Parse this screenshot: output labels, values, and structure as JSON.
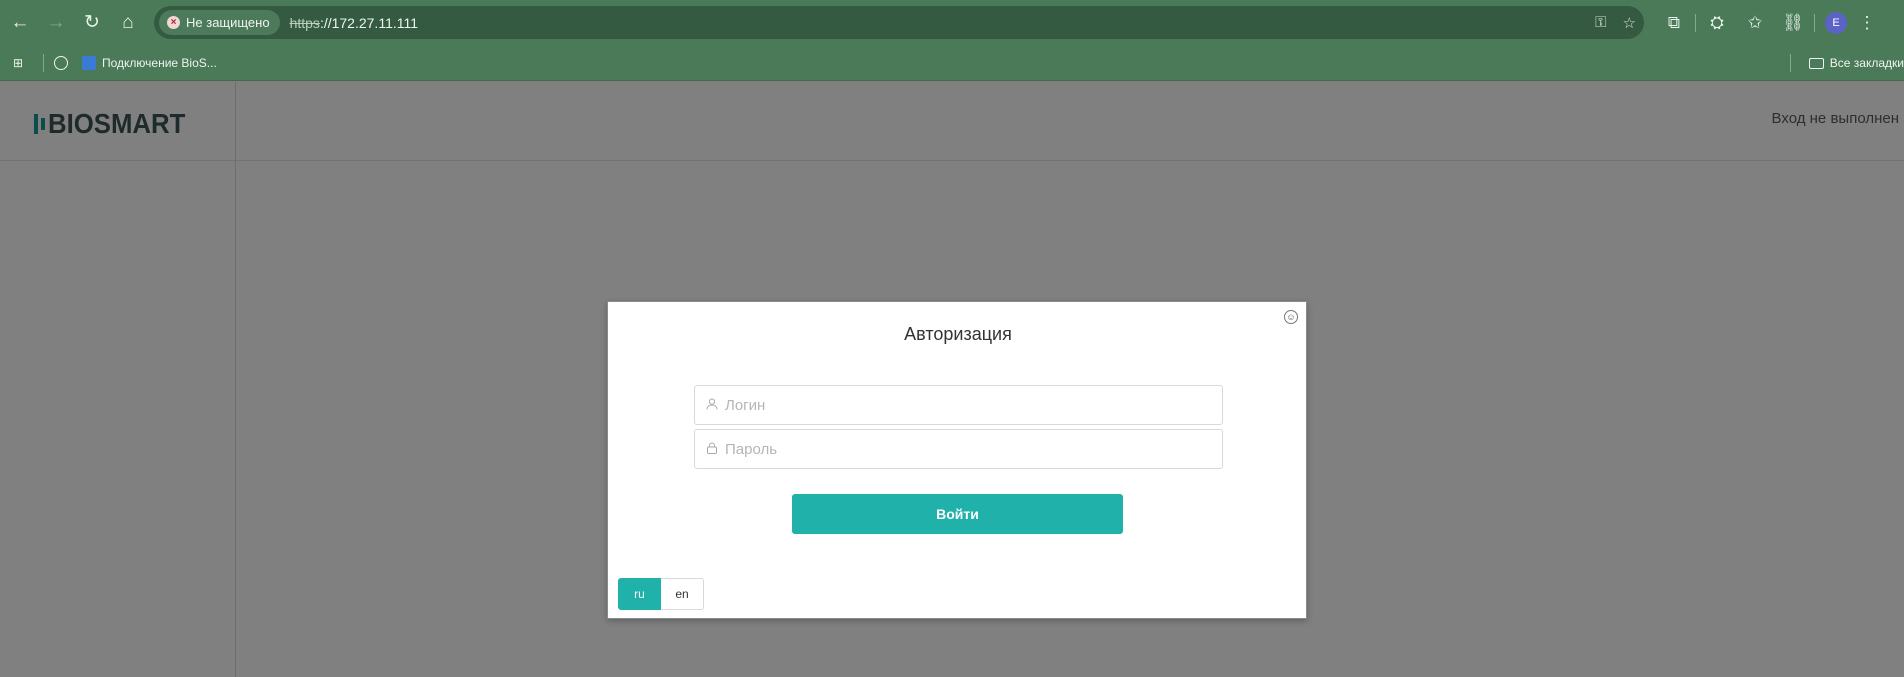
{
  "browser": {
    "nav": {
      "back_icon": "←",
      "forward_icon": "→",
      "reload_icon": "↻",
      "home_icon": "⌂"
    },
    "security_chip": "Не защищено",
    "url_scheme": "https",
    "url_rest": "://172.27.11.111",
    "omni_icons": {
      "password_key_icon": "⚿",
      "bookmark_star_icon": "☆"
    },
    "toolbar": {
      "extensions_icon": "⧉",
      "incognito_icon": "⛭",
      "favorites_icon": "✩",
      "link_icon": "⛓",
      "avatar_letter": "E",
      "menu_icon": "⋮"
    },
    "bookmarks": {
      "apps_icon": "⊞",
      "item_label": "Подключение BioS...",
      "all_bookmarks": "Все закладки"
    }
  },
  "app": {
    "logo_text": "BIOSMART",
    "login_status": "Вход не выполнен"
  },
  "modal": {
    "title": "Авторизация",
    "close_icon": "☺",
    "login_placeholder": "Логин",
    "login_icon": "👤",
    "password_placeholder": "Пароль",
    "password_icon": "🔒",
    "submit_label": "Войти",
    "languages": [
      {
        "code": "ru",
        "active": true
      },
      {
        "code": "en",
        "active": false
      }
    ]
  },
  "colors": {
    "accent": "#20b2aa",
    "browser_frame": "#4a7a58",
    "overlay": "#808080"
  }
}
